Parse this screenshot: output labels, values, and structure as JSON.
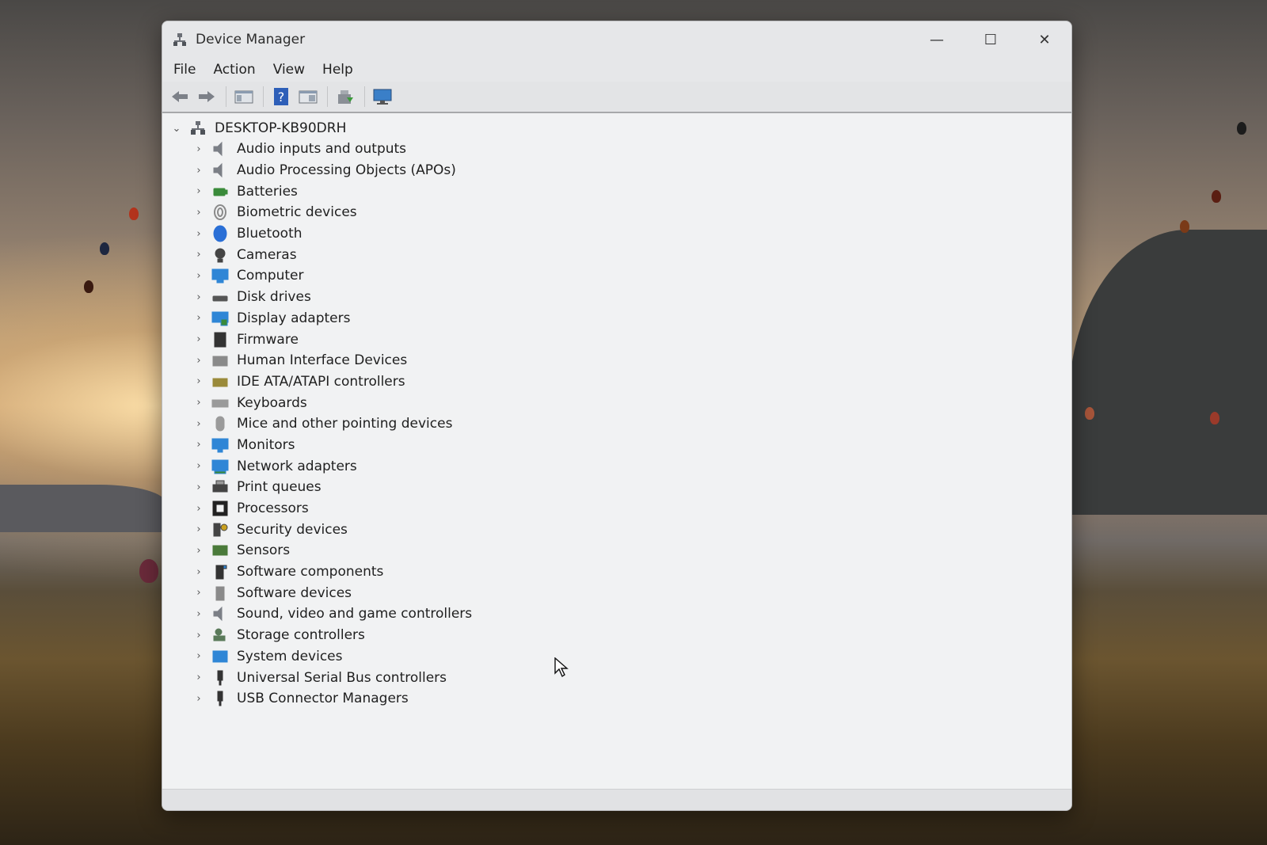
{
  "window": {
    "title": "Device Manager",
    "controls": {
      "minimize": "—",
      "maximize": "☐",
      "close": "✕"
    }
  },
  "menu": [
    "File",
    "Action",
    "View",
    "Help"
  ],
  "toolbar": [
    {
      "icon": "back-arrow-icon"
    },
    {
      "icon": "forward-arrow-icon"
    },
    {
      "icon": "show-hide-console-tree-icon"
    },
    {
      "icon": "help-icon"
    },
    {
      "icon": "properties-icon"
    },
    {
      "icon": "update-driver-icon"
    },
    {
      "icon": "scan-hardware-changes-icon"
    }
  ],
  "tree": {
    "root": "DESKTOP-KB90DRH",
    "categories": [
      {
        "label": "Audio inputs and outputs",
        "icon": "speaker-icon",
        "color": "#7b7f86"
      },
      {
        "label": "Audio Processing Objects (APOs)",
        "icon": "speaker-icon",
        "color": "#7b7f86"
      },
      {
        "label": "Batteries",
        "icon": "battery-icon",
        "color": "#3a8b3a"
      },
      {
        "label": "Biometric devices",
        "icon": "fingerprint-icon",
        "color": "#8a8a8a"
      },
      {
        "label": "Bluetooth",
        "icon": "bluetooth-icon",
        "color": "#2a6fd6"
      },
      {
        "label": "Cameras",
        "icon": "camera-icon",
        "color": "#444444"
      },
      {
        "label": "Computer",
        "icon": "computer-icon",
        "color": "#2f86d6"
      },
      {
        "label": "Disk drives",
        "icon": "disk-drive-icon",
        "color": "#555555"
      },
      {
        "label": "Display adapters",
        "icon": "display-adapter-icon",
        "color": "#2f86d6"
      },
      {
        "label": "Firmware",
        "icon": "firmware-icon",
        "color": "#333333"
      },
      {
        "label": "Human Interface Devices",
        "icon": "hid-icon",
        "color": "#8a8a8a"
      },
      {
        "label": "IDE ATA/ATAPI controllers",
        "icon": "ide-controller-icon",
        "color": "#9a8a3a"
      },
      {
        "label": "Keyboards",
        "icon": "keyboard-icon",
        "color": "#9a9a9a"
      },
      {
        "label": "Mice and other pointing devices",
        "icon": "mouse-icon",
        "color": "#9a9a9a"
      },
      {
        "label": "Monitors",
        "icon": "monitor-icon",
        "color": "#2f86d6"
      },
      {
        "label": "Network adapters",
        "icon": "network-adapter-icon",
        "color": "#2f86d6"
      },
      {
        "label": "Print queues",
        "icon": "printer-icon",
        "color": "#444444"
      },
      {
        "label": "Processors",
        "icon": "processor-icon",
        "color": "#222222"
      },
      {
        "label": "Security devices",
        "icon": "security-device-icon",
        "color": "#444444"
      },
      {
        "label": "Sensors",
        "icon": "sensor-icon",
        "color": "#4a7a3a"
      },
      {
        "label": "Software components",
        "icon": "software-component-icon",
        "color": "#333333"
      },
      {
        "label": "Software devices",
        "icon": "software-device-icon",
        "color": "#8a8a8a"
      },
      {
        "label": "Sound, video and game controllers",
        "icon": "speaker-icon",
        "color": "#7b7f86"
      },
      {
        "label": "Storage controllers",
        "icon": "storage-controller-icon",
        "color": "#5a7a5a"
      },
      {
        "label": "System devices",
        "icon": "system-devices-icon",
        "color": "#2f86d6"
      },
      {
        "label": "Universal Serial Bus controllers",
        "icon": "usb-icon",
        "color": "#333333"
      },
      {
        "label": "USB Connector Managers",
        "icon": "usb-icon",
        "color": "#333333"
      }
    ]
  },
  "status": ""
}
